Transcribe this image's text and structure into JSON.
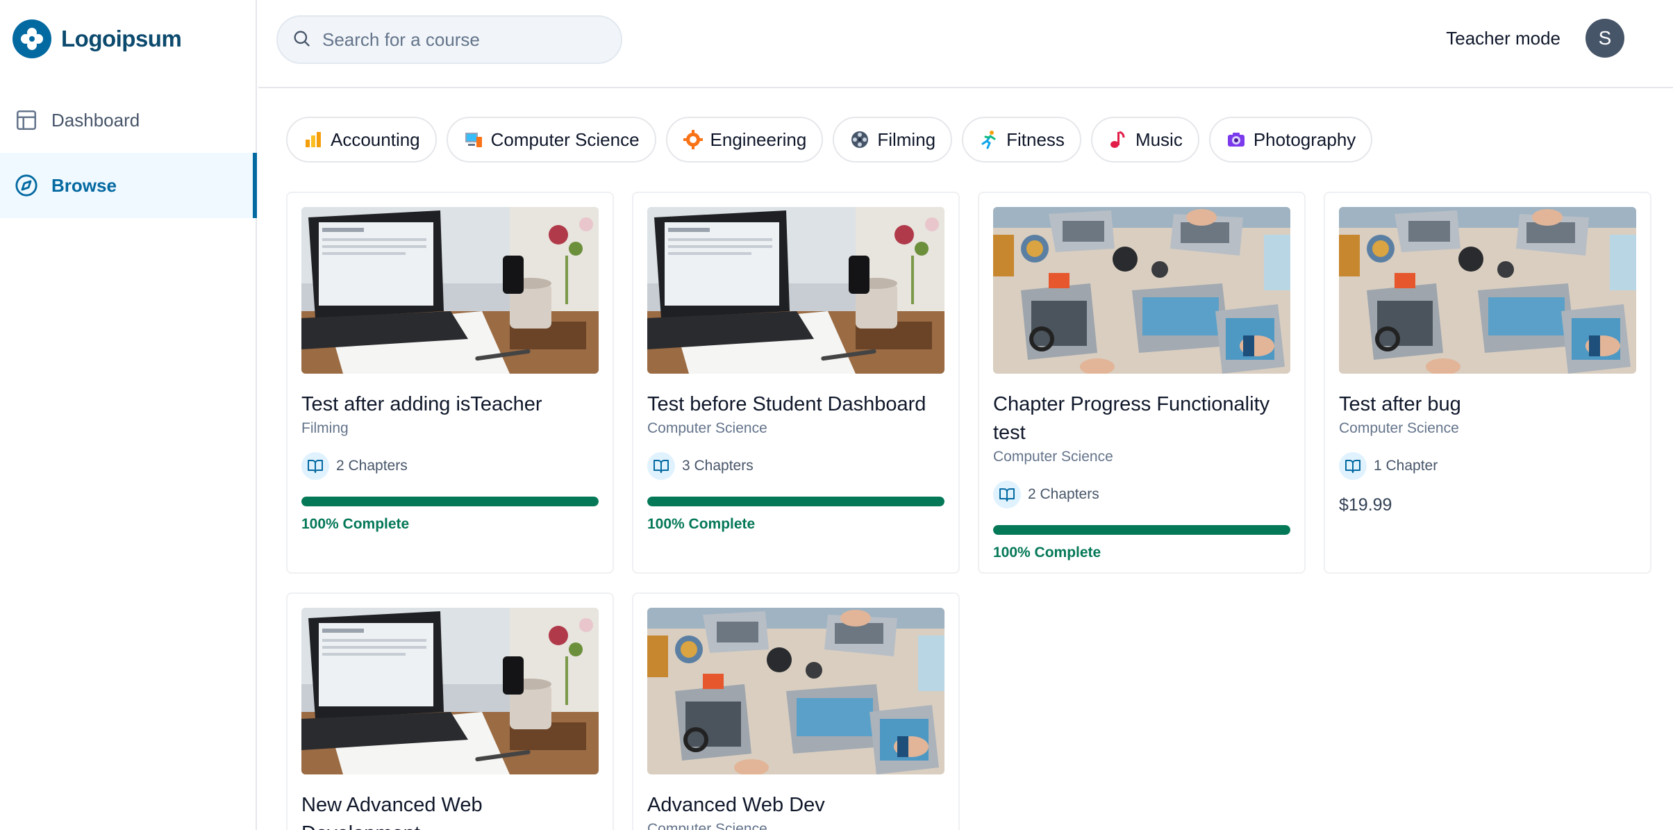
{
  "brand": {
    "name": "Logoipsum"
  },
  "sidebar": {
    "items": [
      {
        "label": "Dashboard",
        "icon": "layout-icon",
        "active": false
      },
      {
        "label": "Browse",
        "icon": "compass-icon",
        "active": true
      }
    ]
  },
  "header": {
    "search_placeholder": "Search for a course",
    "teacher_mode_label": "Teacher mode",
    "avatar_initial": "S"
  },
  "categories": [
    {
      "label": "Accounting",
      "icon": "bar-chart-icon"
    },
    {
      "label": "Computer Science",
      "icon": "computer-icon"
    },
    {
      "label": "Engineering",
      "icon": "gear-icon"
    },
    {
      "label": "Filming",
      "icon": "film-reel-icon"
    },
    {
      "label": "Fitness",
      "icon": "runner-icon"
    },
    {
      "label": "Music",
      "icon": "music-note-icon"
    },
    {
      "label": "Photography",
      "icon": "camera-icon"
    }
  ],
  "courses": [
    {
      "title": "Test after adding isTeacher",
      "category": "Filming",
      "chapters": "2 Chapters",
      "progress": 100,
      "progress_label": "100% Complete",
      "image": "laptop-desk"
    },
    {
      "title": "Test before Student Dashboard",
      "category": "Computer Science",
      "chapters": "3 Chapters",
      "progress": 100,
      "progress_label": "100% Complete",
      "image": "laptop-desk"
    },
    {
      "title": "Chapter Progress Functionality test",
      "category": "Computer Science",
      "chapters": "2 Chapters",
      "progress": 100,
      "progress_label": "100% Complete",
      "image": "team-table"
    },
    {
      "title": "Test after bug",
      "category": "Computer Science",
      "chapters": "1 Chapter",
      "price": "$19.99",
      "image": "team-table"
    },
    {
      "title": "New Advanced Web Development",
      "category": "",
      "chapters": "",
      "image": "laptop-desk"
    },
    {
      "title": "Advanced Web Dev",
      "category": "Computer Science",
      "chapters": "",
      "image": "team-table"
    }
  ],
  "colors": {
    "brand": "#0369a1",
    "progress": "#047857",
    "active_bg": "#f0f9ff"
  }
}
